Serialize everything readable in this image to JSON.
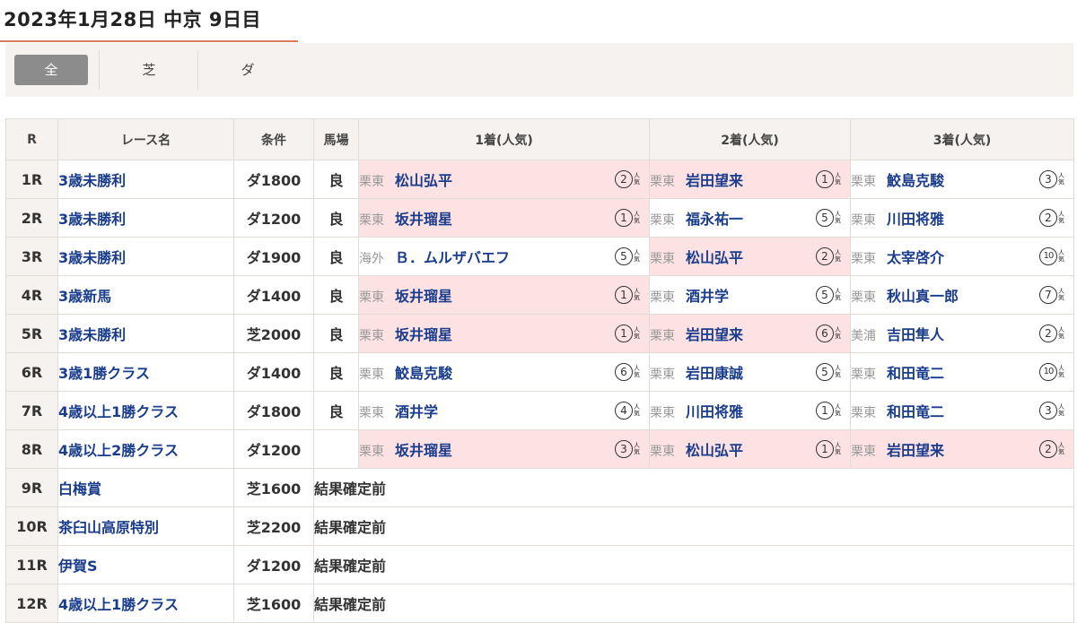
{
  "title": "2023年1月28日 中京 9日目",
  "filters": [
    {
      "label": "全",
      "active": true
    },
    {
      "label": "芝",
      "active": false
    },
    {
      "label": "ダ",
      "active": false
    }
  ],
  "headers": {
    "r": "R",
    "name": "レース名",
    "cond": "条件",
    "track": "馬場",
    "first": "1着(人気)",
    "second": "2着(人気)",
    "third": "3着(人気)"
  },
  "pop_label": "人気",
  "races": [
    {
      "r": "1R",
      "name": "3歳未勝利",
      "cond": "ダ1800",
      "track": "良",
      "places": [
        {
          "aff": "栗東",
          "jockey": "松山弘平",
          "pop": "2",
          "hl": true
        },
        {
          "aff": "栗東",
          "jockey": "岩田望来",
          "pop": "1",
          "hl": true
        },
        {
          "aff": "栗東",
          "jockey": "鮫島克駿",
          "pop": "3",
          "hl": false
        }
      ]
    },
    {
      "r": "2R",
      "name": "3歳未勝利",
      "cond": "ダ1200",
      "track": "良",
      "places": [
        {
          "aff": "栗東",
          "jockey": "坂井瑠星",
          "pop": "1",
          "hl": true
        },
        {
          "aff": "栗東",
          "jockey": "福永祐一",
          "pop": "5",
          "hl": false
        },
        {
          "aff": "栗東",
          "jockey": "川田将雅",
          "pop": "2",
          "hl": false
        }
      ]
    },
    {
      "r": "3R",
      "name": "3歳未勝利",
      "cond": "ダ1900",
      "track": "良",
      "places": [
        {
          "aff": "海外",
          "jockey": "Ｂ．ムルザバエフ",
          "pop": "5",
          "hl": false
        },
        {
          "aff": "栗東",
          "jockey": "松山弘平",
          "pop": "2",
          "hl": true
        },
        {
          "aff": "栗東",
          "jockey": "太宰啓介",
          "pop": "10",
          "hl": false
        }
      ]
    },
    {
      "r": "4R",
      "name": "3歳新馬",
      "cond": "ダ1400",
      "track": "良",
      "places": [
        {
          "aff": "栗東",
          "jockey": "坂井瑠星",
          "pop": "1",
          "hl": true
        },
        {
          "aff": "栗東",
          "jockey": "酒井学",
          "pop": "5",
          "hl": false
        },
        {
          "aff": "栗東",
          "jockey": "秋山真一郎",
          "pop": "7",
          "hl": false
        }
      ]
    },
    {
      "r": "5R",
      "name": "3歳未勝利",
      "cond": "芝2000",
      "track": "良",
      "places": [
        {
          "aff": "栗東",
          "jockey": "坂井瑠星",
          "pop": "1",
          "hl": true
        },
        {
          "aff": "栗東",
          "jockey": "岩田望来",
          "pop": "6",
          "hl": true
        },
        {
          "aff": "美浦",
          "jockey": "吉田隼人",
          "pop": "2",
          "hl": false
        }
      ]
    },
    {
      "r": "6R",
      "name": "3歳1勝クラス",
      "cond": "ダ1400",
      "track": "良",
      "places": [
        {
          "aff": "栗東",
          "jockey": "鮫島克駿",
          "pop": "6",
          "hl": false
        },
        {
          "aff": "栗東",
          "jockey": "岩田康誠",
          "pop": "5",
          "hl": false
        },
        {
          "aff": "栗東",
          "jockey": "和田竜二",
          "pop": "10",
          "hl": false
        }
      ]
    },
    {
      "r": "7R",
      "name": "4歳以上1勝クラス",
      "cond": "ダ1800",
      "track": "良",
      "places": [
        {
          "aff": "栗東",
          "jockey": "酒井学",
          "pop": "4",
          "hl": false
        },
        {
          "aff": "栗東",
          "jockey": "川田将雅",
          "pop": "1",
          "hl": false
        },
        {
          "aff": "栗東",
          "jockey": "和田竜二",
          "pop": "3",
          "hl": false
        }
      ]
    },
    {
      "r": "8R",
      "name": "4歳以上2勝クラス",
      "cond": "ダ1200",
      "track": "",
      "places": [
        {
          "aff": "栗東",
          "jockey": "坂井瑠星",
          "pop": "3",
          "hl": true
        },
        {
          "aff": "栗東",
          "jockey": "松山弘平",
          "pop": "1",
          "hl": true
        },
        {
          "aff": "栗東",
          "jockey": "岩田望来",
          "pop": "2",
          "hl": true
        }
      ]
    },
    {
      "r": "9R",
      "name": "白梅賞",
      "cond": "芝1600",
      "pending": "結果確定前"
    },
    {
      "r": "10R",
      "name": "茶臼山高原特別",
      "cond": "芝2200",
      "pending": "結果確定前"
    },
    {
      "r": "11R",
      "name": "伊賀S",
      "cond": "ダ1200",
      "pending": "結果確定前"
    },
    {
      "r": "12R",
      "name": "4歳以上1勝クラス",
      "cond": "芝1600",
      "pending": "結果確定前"
    }
  ]
}
